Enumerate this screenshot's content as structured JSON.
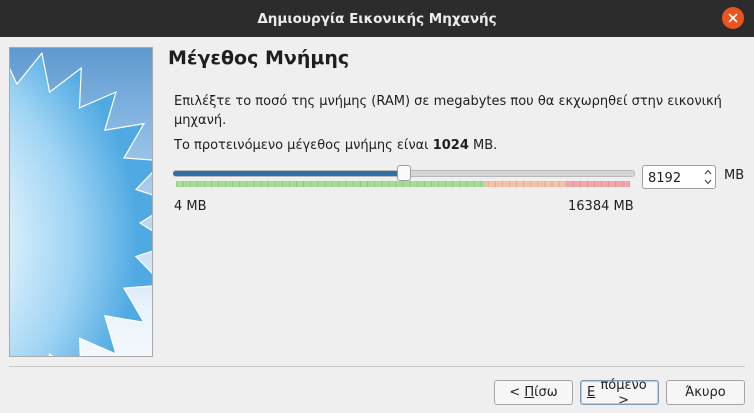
{
  "window": {
    "title": "Δημιουργία Εικονικής Μηχανής",
    "close_icon": "close-icon",
    "accent_color": "#e95420"
  },
  "page": {
    "title": "Μέγεθος Μνήμης",
    "description": "Επιλέξτε το ποσό της μνήμης (RAM) σε megabytes που θα εκχωρηθεί στην εικονική μηχανή.",
    "recommended_prefix": "Το προτεινόμενο μέγεθος μνήμης είναι ",
    "recommended_value": "1024",
    "recommended_suffix": " MB."
  },
  "memory": {
    "value": "8192",
    "unit": "MB",
    "min_label": "4 MB",
    "max_label": "16384 MB",
    "slider_min": 4,
    "slider_max": 16384,
    "slider_value": 8192,
    "zones": {
      "green_end_fraction": 0.68,
      "orange_end_fraction": 0.86,
      "green_color": "#a4de95",
      "orange_color": "#f5c2a6",
      "red_color": "#f0a8a8"
    }
  },
  "buttons": {
    "back_mnemonic": "<",
    "back_prefix": " ",
    "back_underlined": "Π",
    "back_rest": "ίσω",
    "next_prefix": "",
    "next_underlined": "Ε",
    "next_rest": "πόμενο >",
    "cancel": "Άκυρο"
  }
}
